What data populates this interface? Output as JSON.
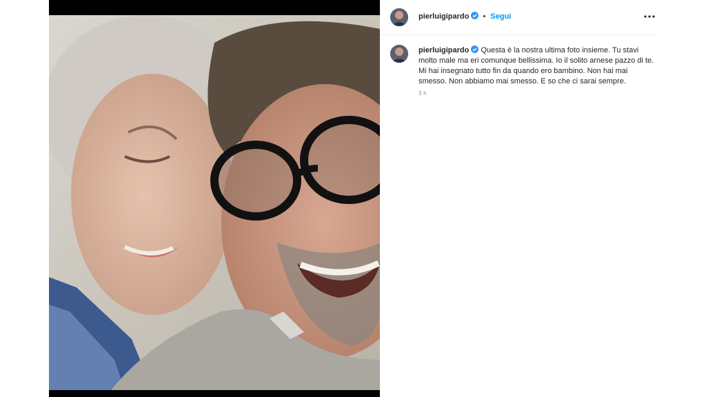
{
  "post": {
    "author": {
      "username": "pierluigipardo",
      "verified": true,
      "avatar": "avatar-photo"
    },
    "follow_separator": "•",
    "follow_label": "Segui",
    "more_icon": "ellipsis-horizontal-icon",
    "caption": "Questa è la nostra ultima foto insieme. Tu stavi molto male ma eri comunque bellissima. Io il solito arnese pazzo di te. Mi hai insegnato tutto fin da quando ero bambino. Non hai mai smesso. Non abbiamo mai smesso. E so che ci sarai sempre.",
    "timestamp": "3 h",
    "image": "selfie-photo"
  },
  "colors": {
    "link_blue": "#0095f6",
    "verified_blue": "#3897f0",
    "text": "#262626",
    "muted": "#8e8e8e",
    "divider": "#efefef"
  }
}
